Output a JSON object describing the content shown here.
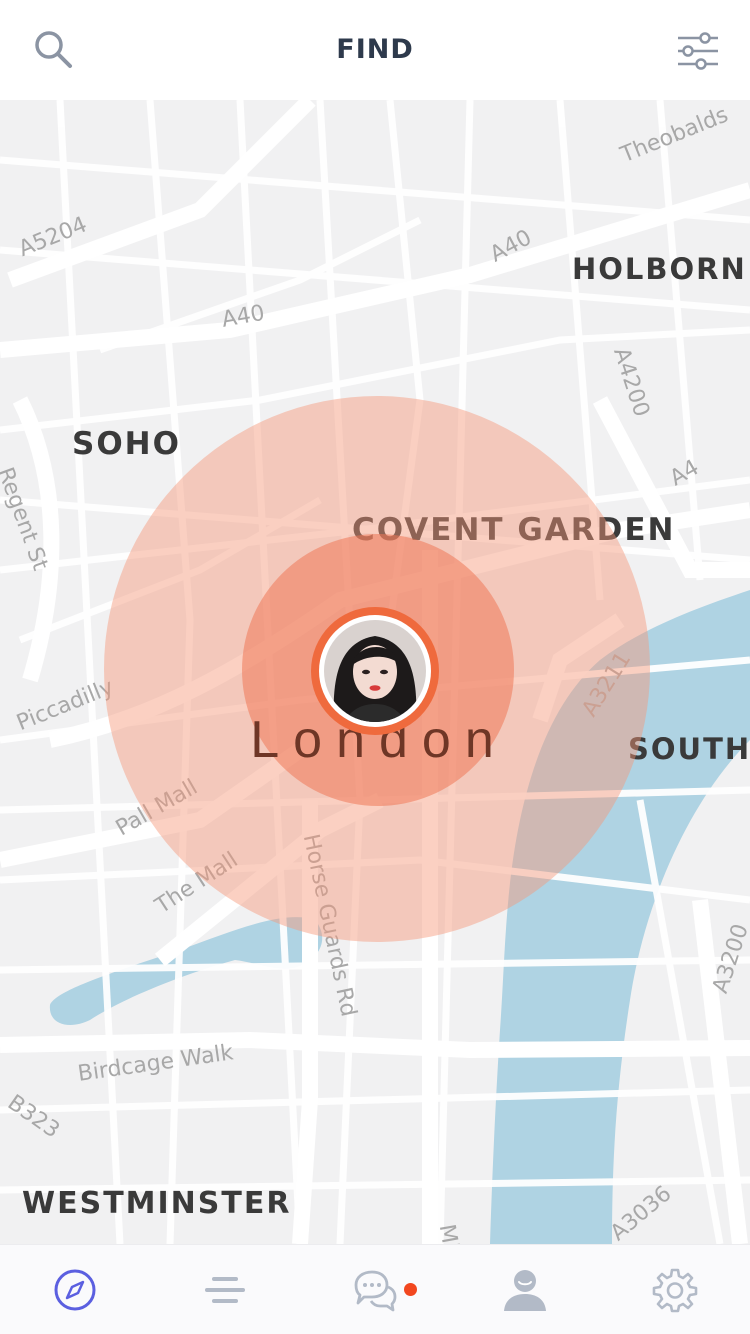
{
  "header": {
    "title": "FIND",
    "search_icon": "search-icon",
    "filter_icon": "sliders-icon"
  },
  "map": {
    "areas": {
      "holborn": "HOLBORN",
      "soho": "SOHO",
      "covent_garden": "COVENT GARDEN",
      "south": "SOUTH",
      "westminster": "WESTMINSTER"
    },
    "roads": {
      "a5204": "A5204",
      "a40_top": "A40",
      "a40_mid": "A40",
      "theobalds": "Theobalds",
      "a4200": "A4200",
      "a4": "A4",
      "regent_st": "Regent St",
      "piccadilly": "Piccadilly",
      "a3211": "A3211",
      "pall_mall": "Pall Mall",
      "the_mall": "The Mall",
      "horse_guards": "Horse Guards Rd",
      "a3200": "A3200",
      "birdcage": "Birdcage Walk",
      "b323": "B323",
      "a3036": "A3036",
      "millbank": "Millbank"
    },
    "current_location": "London"
  },
  "colors": {
    "accent": "#ef6a3d",
    "nav_active": "#5b5fe0",
    "notification": "#f2471f",
    "water": "#afd3e3"
  },
  "tabbar": {
    "tabs": [
      {
        "icon": "compass-icon",
        "active": true
      },
      {
        "icon": "list-icon",
        "active": false
      },
      {
        "icon": "chat-icon",
        "active": false,
        "has_notification": true
      },
      {
        "icon": "profile-icon",
        "active": false
      },
      {
        "icon": "gear-icon",
        "active": false
      }
    ]
  }
}
